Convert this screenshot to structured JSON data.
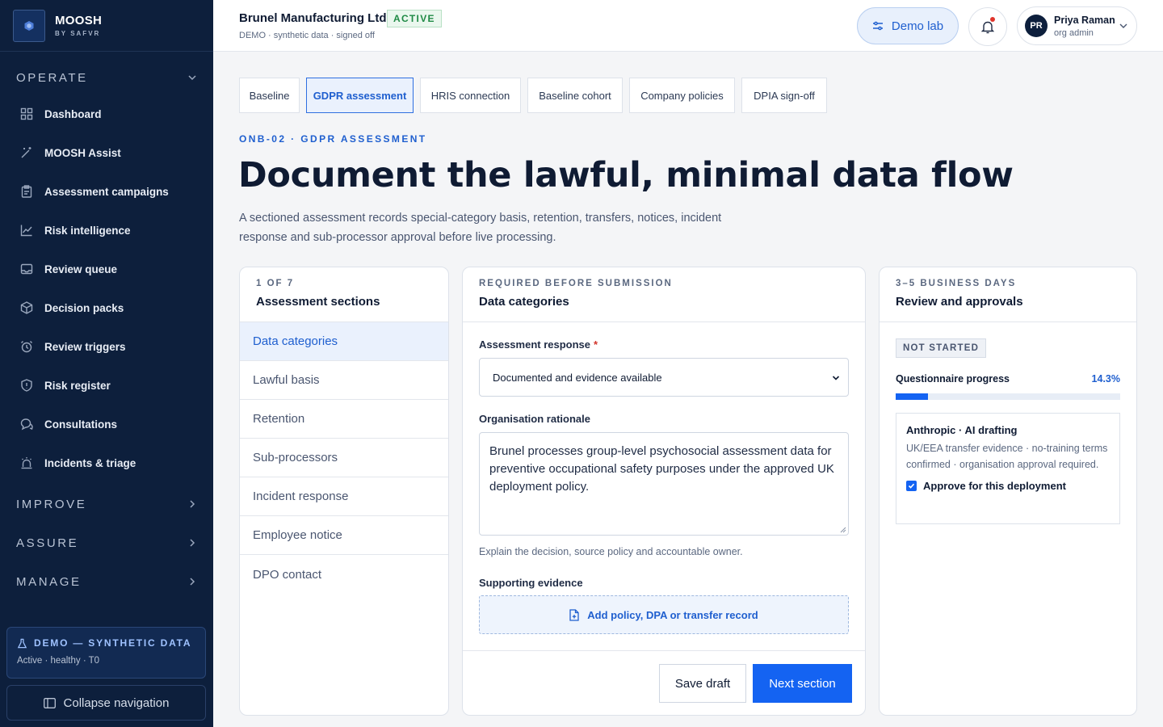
{
  "brand": {
    "name": "MOOSH",
    "sub": "BY SAFVR"
  },
  "nav": {
    "operate_label": "OPERATE",
    "items": [
      {
        "label": "Dashboard",
        "icon": "grid-icon"
      },
      {
        "label": "MOOSH Assist",
        "icon": "magic-wand-icon"
      },
      {
        "label": "Assessment campaigns",
        "icon": "clipboard-icon"
      },
      {
        "label": "Risk intelligence",
        "icon": "chart-line-icon"
      },
      {
        "label": "Review queue",
        "icon": "inbox-icon"
      },
      {
        "label": "Decision packs",
        "icon": "package-icon"
      },
      {
        "label": "Review triggers",
        "icon": "alarm-clock-icon"
      },
      {
        "label": "Risk register",
        "icon": "shield-icon"
      },
      {
        "label": "Consultations",
        "icon": "chat-icon"
      },
      {
        "label": "Incidents & triage",
        "icon": "siren-icon"
      }
    ],
    "improve_label": "IMPROVE",
    "assure_label": "ASSURE",
    "manage_label": "MANAGE"
  },
  "demo_card": {
    "title": "DEMO — SYNTHETIC DATA",
    "sub": "Active · healthy · T0"
  },
  "collapse_label": "Collapse navigation",
  "topbar": {
    "org_name": "Brunel Manufacturing Ltd",
    "org_status": "ACTIVE",
    "org_sub": "DEMO · synthetic data · signed off",
    "demo_lab_label": "Demo lab",
    "user": {
      "initials": "PR",
      "name": "Priya Raman",
      "role": "org admin"
    }
  },
  "tabs": [
    {
      "label": "Baseline"
    },
    {
      "label": "GDPR assessment",
      "active": true
    },
    {
      "label": "HRIS connection"
    },
    {
      "label": "Baseline cohort"
    },
    {
      "label": "Company policies"
    },
    {
      "label": "DPIA sign-off"
    }
  ],
  "page": {
    "eyebrow": "ONB-02 · GDPR ASSESSMENT",
    "title": "Document the lawful, minimal data flow",
    "description": "A sectioned assessment records special-category basis, retention, transfers, notices, incident response and sub-processor approval before live processing."
  },
  "sections_panel": {
    "eyebrow": "1 OF 7",
    "title": "Assessment sections",
    "items": [
      "Data categories",
      "Lawful basis",
      "Retention",
      "Sub-processors",
      "Incident response",
      "Employee notice",
      "DPO contact"
    ]
  },
  "form_panel": {
    "eyebrow": "REQUIRED BEFORE SUBMISSION",
    "title": "Data categories",
    "response_label": "Assessment response",
    "required_mark": "*",
    "response_value": "Documented and evidence available",
    "rationale_label": "Organisation rationale",
    "rationale_value": "Brunel processes group-level psychosocial assessment data for preventive occupational safety purposes under the approved UK deployment policy.",
    "rationale_help": "Explain the decision, source policy and accountable owner.",
    "evidence_label": "Supporting evidence",
    "evidence_action": "Add policy, DPA or transfer record",
    "save_label": "Save draft",
    "next_label": "Next section"
  },
  "review_panel": {
    "eyebrow": "3–5 BUSINESS DAYS",
    "title": "Review and approvals",
    "status": "NOT STARTED",
    "progress_label": "Questionnaire progress",
    "progress_value": "14.3%",
    "progress_fraction": 0.143,
    "vendor": {
      "title": "Anthropic · AI drafting",
      "description": "UK/EEA transfer evidence · no-training terms confirmed · organisation approval required.",
      "checkbox_label": "Approve for this deployment",
      "checked": true
    }
  },
  "colors": {
    "sidebar_bg": "#0d1f3c",
    "accent": "#1463f2",
    "accent_text": "#1f5fcf",
    "active_green": "#1f8a45",
    "notification_red": "#e0342b"
  }
}
